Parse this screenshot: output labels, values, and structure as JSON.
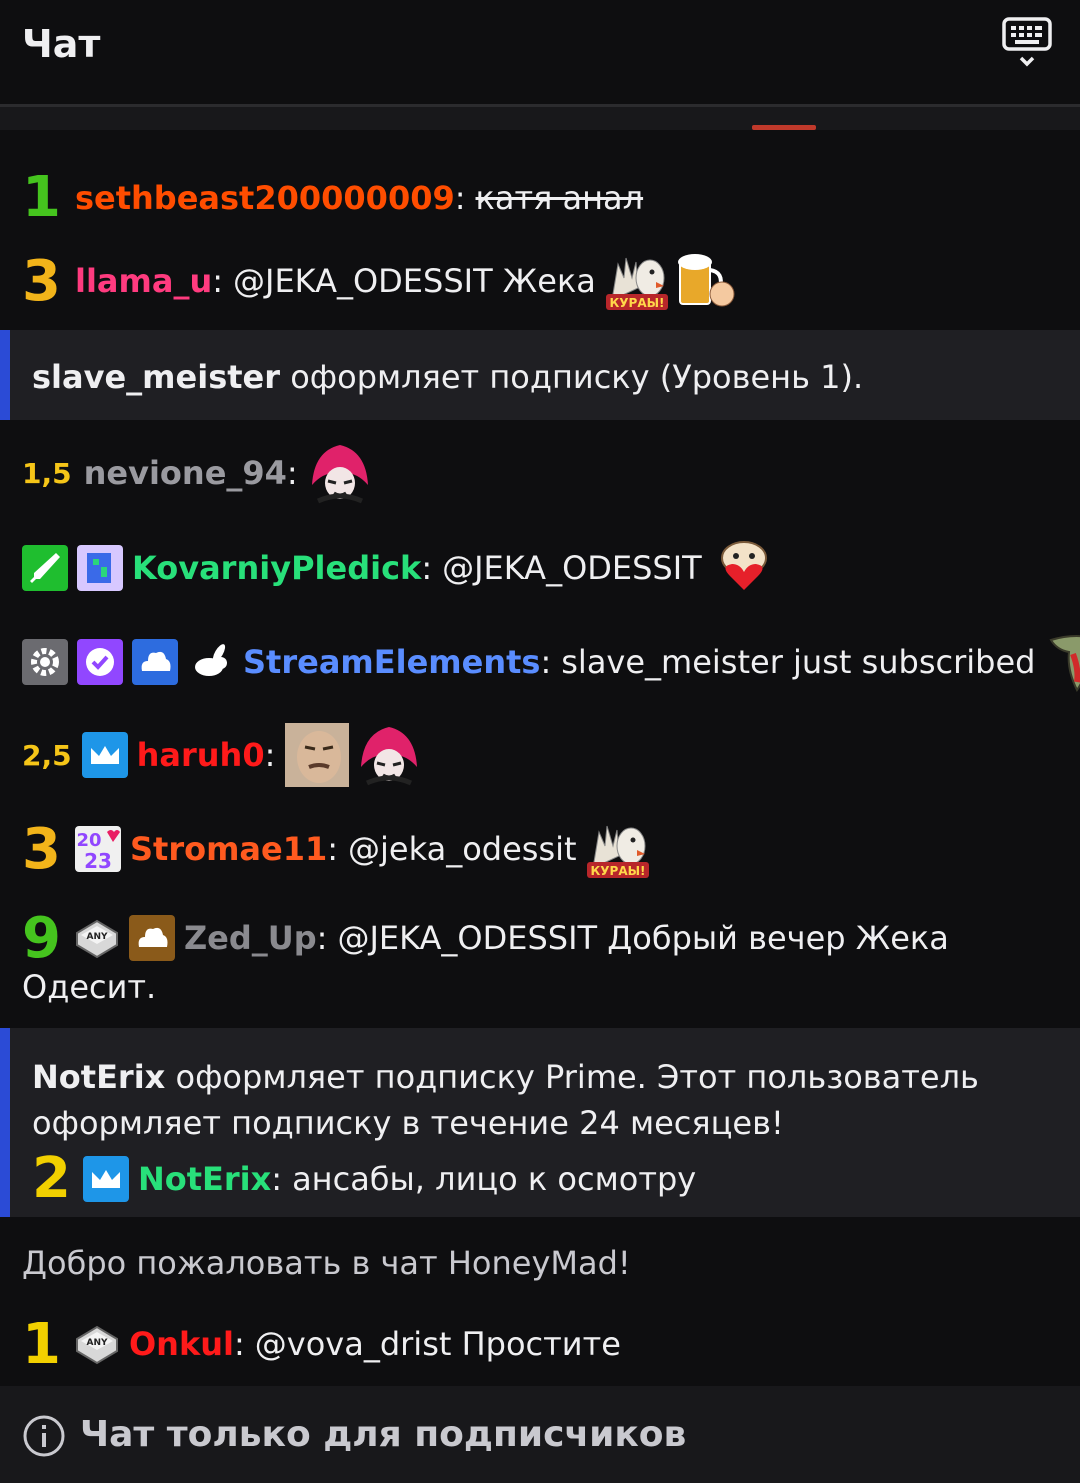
{
  "header": {
    "title": "Чат",
    "keyboard_icon": "keyboard-icon"
  },
  "messages": [
    {
      "badge_text": "1",
      "badge_color": "#45c41e",
      "username": "sethbeast200000009",
      "user_color": "#ff4d00",
      "text": "катя анал",
      "struck": true
    },
    {
      "badge_text": "3",
      "badge_color": "#f2b41a",
      "username": "llama_u",
      "user_color": "#ff3b7f",
      "text": "@JEKA_ODESSIT Жека",
      "emotes": [
        "kuryi-emote",
        "beer-emote"
      ]
    },
    {
      "badge_text": "1,5",
      "badge_color": "#f5c518",
      "username": "nevione_94",
      "user_color": "#9a9aa0",
      "emotes": [
        "pink-hair-emote"
      ]
    },
    {
      "username": "KovarniyPledick",
      "user_color": "#28e07a",
      "text": "@JEKA_ODESSIT",
      "badges": [
        "sword-badge",
        "pixel-badge"
      ],
      "emotes": [
        "heart-cat-emote"
      ]
    },
    {
      "username": "StreamElements",
      "user_color": "#5a8dff",
      "text": "slave_meister just subscribed",
      "badges": [
        "gear-badge",
        "verified-badge",
        "cloud-badge",
        "rabbit-badge"
      ],
      "emotes": [
        "dino-emote"
      ]
    },
    {
      "badge_text": "2,5",
      "badge_color": "#f5c518",
      "username": "haruh0",
      "user_color": "#ff1a1a",
      "badges": [
        "crown-badge"
      ],
      "emotes": [
        "face-emote",
        "pink-hair-emote"
      ]
    },
    {
      "badge_text": "3",
      "badge_color": "#f2b41a",
      "username": "Stromae11",
      "user_color": "#ff5a1f",
      "text": "@jeka_odessit",
      "badges": [
        "year-2023-badge"
      ],
      "emotes": [
        "kuryi-emote"
      ]
    },
    {
      "badge_text": "9",
      "badge_color": "#45c41e",
      "username": "Zed_Up",
      "user_color": "#8a8a8f",
      "text_line1": "@JEKA_ODESSIT Добрый вечер Жека",
      "text_line2": "Одесит.",
      "badges": [
        "any-key-badge",
        "cloud-gold-badge"
      ]
    }
  ],
  "notices": {
    "sub1_user": "slave_meister",
    "sub1_text": "оформляет подписку (Уровень 1).",
    "prime_user": "NotErix",
    "prime_line1": "оформляет подписку Prime. Этот пользователь",
    "prime_line2": "оформляет подписку в течение 24 месяцев!",
    "prime_msg_badge": "2",
    "prime_msg_user": "NotErix",
    "prime_msg_text": "ансабы, лицо к осмотру"
  },
  "welcome": "Добро пожаловать в чат HoneyMad!",
  "last_message": {
    "badge_text": "1",
    "username": "Onkul",
    "text": "@vova_drist Простите"
  },
  "footer": {
    "text": "Чат только для подписчиков"
  },
  "labels": {
    "colon": ":",
    "kuryi": "КУРАЫ!",
    "year_top": "20",
    "year_bottom": "23",
    "any": "ANY"
  }
}
